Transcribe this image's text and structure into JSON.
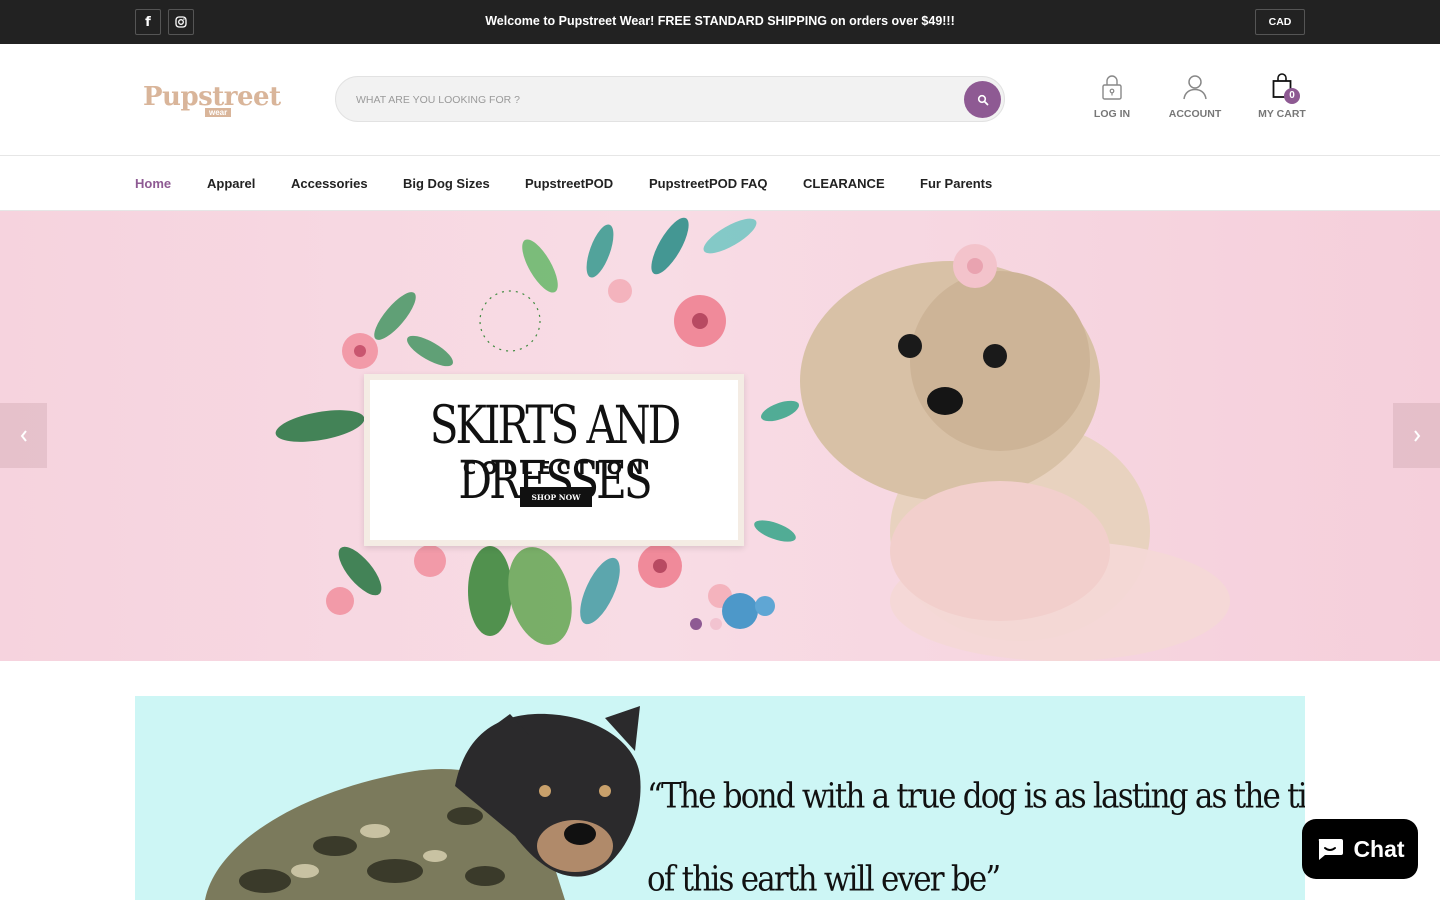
{
  "topbar": {
    "announcement": "Welcome to Pupstreet Wear! FREE STANDARD SHIPPING on orders over $49!!!",
    "currency": "CAD",
    "social": [
      {
        "icon": "facebook-icon",
        "glyph": "f"
      },
      {
        "icon": "instagram-icon"
      }
    ]
  },
  "header": {
    "logo": {
      "main": "Pupstreet",
      "sub": "wear"
    },
    "search": {
      "placeholder": "WHAT ARE YOU LOOKING FOR ?",
      "value": "",
      "button_icon": "search-icon"
    },
    "login_label": "LOG IN",
    "account_label": "ACCOUNT",
    "cart_label": "MY CART",
    "cart_count": "0"
  },
  "nav": {
    "items": [
      {
        "label": "Home",
        "active": true
      },
      {
        "label": "Apparel"
      },
      {
        "label": "Accessories"
      },
      {
        "label": "Big Dog Sizes"
      },
      {
        "label": "PupstreetPOD"
      },
      {
        "label": "PupstreetPOD FAQ"
      },
      {
        "label": "CLEARANCE"
      },
      {
        "label": "Fur Parents"
      }
    ]
  },
  "hero": {
    "title": "SKIRTS AND DRESSES",
    "subtitle": "COLLECTION",
    "cta": "SHOP NOW",
    "slides_total": 2,
    "active_slide": 1
  },
  "quote": {
    "line1": "“The bond with a true dog is as lasting as the ties",
    "line2": "of this earth will ever be”"
  },
  "chat": {
    "label": "Chat",
    "icon": "chat-bubble-icon"
  },
  "colors": {
    "accent": "#8e5a93",
    "topbar": "#222222",
    "logo": "#d9b59a",
    "hero_bg": "#f6d3de",
    "quote_bg": "#cdf6f5"
  }
}
